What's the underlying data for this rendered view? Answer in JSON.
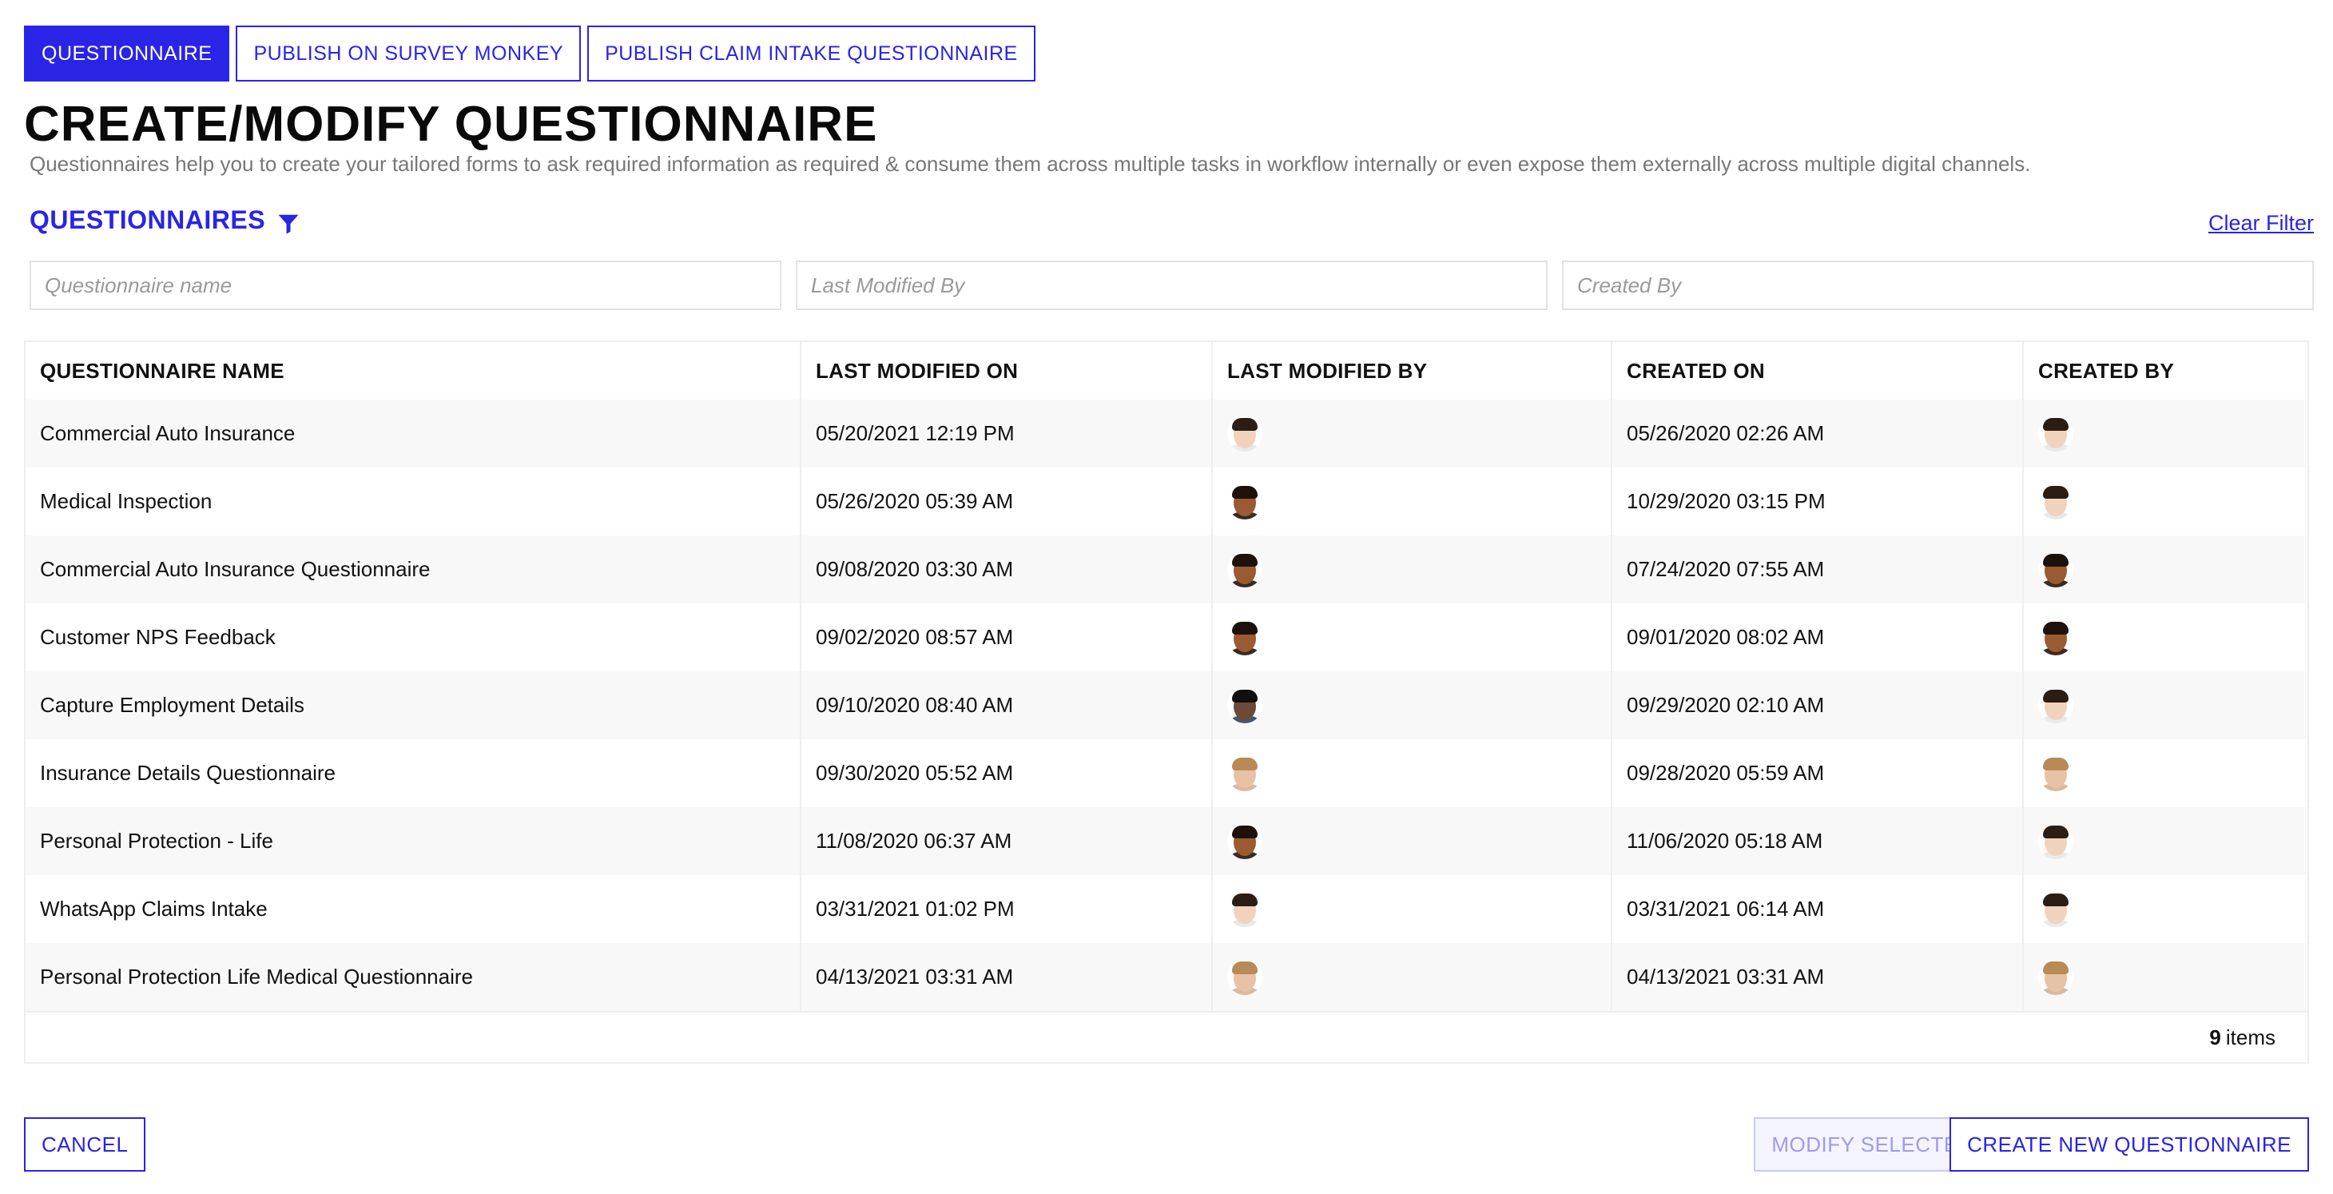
{
  "tabs": [
    {
      "label": "QUESTIONNAIRE",
      "active": true
    },
    {
      "label": "PUBLISH ON SURVEY MONKEY",
      "active": false
    },
    {
      "label": "PUBLISH CLAIM INTAKE QUESTIONNAIRE",
      "active": false
    }
  ],
  "page": {
    "title": "CREATE/MODIFY QUESTIONNAIRE",
    "description": "Questionnaires help you to create your tailored forms to ask required information as required & consume them across multiple tasks in workflow internally or even expose them externally across multiple digital channels."
  },
  "section": {
    "title": "QUESTIONNAIRES",
    "filter_icon": "filter-icon",
    "clear_filter": "Clear Filter"
  },
  "filters": {
    "name_placeholder": "Questionnaire name",
    "modified_by_placeholder": "Last Modified By",
    "created_by_placeholder": "Created By"
  },
  "table": {
    "headers": [
      "QUESTIONNAIRE NAME",
      "LAST MODIFIED ON",
      "LAST MODIFIED BY",
      "CREATED ON",
      "CREATED BY"
    ],
    "rows": [
      {
        "name": "Commercial Auto Insurance",
        "modified_on": "05/20/2021 12:19 PM",
        "modified_by_avatar": "avatar-a",
        "created_on": "05/26/2020 02:26 AM",
        "created_by_avatar": "avatar-a"
      },
      {
        "name": "Medical Inspection",
        "modified_on": "05/26/2020 05:39 AM",
        "modified_by_avatar": "avatar-b",
        "created_on": "10/29/2020 03:15 PM",
        "created_by_avatar": "avatar-a"
      },
      {
        "name": "Commercial Auto Insurance Questionnaire",
        "modified_on": "09/08/2020 03:30 AM",
        "modified_by_avatar": "avatar-b",
        "created_on": "07/24/2020 07:55 AM",
        "created_by_avatar": "avatar-b"
      },
      {
        "name": "Customer NPS Feedback",
        "modified_on": "09/02/2020 08:57 AM",
        "modified_by_avatar": "avatar-b",
        "created_on": "09/01/2020 08:02 AM",
        "created_by_avatar": "avatar-b"
      },
      {
        "name": "Capture Employment Details",
        "modified_on": "09/10/2020 08:40 AM",
        "modified_by_avatar": "avatar-c",
        "created_on": "09/29/2020 02:10 AM",
        "created_by_avatar": "avatar-a"
      },
      {
        "name": "Insurance Details Questionnaire",
        "modified_on": "09/30/2020 05:52 AM",
        "modified_by_avatar": "avatar-d",
        "created_on": "09/28/2020 05:59 AM",
        "created_by_avatar": "avatar-d"
      },
      {
        "name": "Personal Protection - Life",
        "modified_on": "11/08/2020 06:37 AM",
        "modified_by_avatar": "avatar-b",
        "created_on": "11/06/2020 05:18 AM",
        "created_by_avatar": "avatar-a"
      },
      {
        "name": "WhatsApp Claims Intake",
        "modified_on": "03/31/2021 01:02 PM",
        "modified_by_avatar": "avatar-a",
        "created_on": "03/31/2021 06:14 AM",
        "created_by_avatar": "avatar-a"
      },
      {
        "name": "Personal Protection Life Medical Questionnaire",
        "modified_on": "04/13/2021 03:31 AM",
        "modified_by_avatar": "avatar-d",
        "created_on": "04/13/2021 03:31 AM",
        "created_by_avatar": "avatar-d"
      }
    ],
    "item_count": "9",
    "item_label": "items"
  },
  "avatars": {
    "avatar-a": {
      "skin": "#f1d3bd",
      "hair": "#2b1d14",
      "shirt": "#e9e9e9"
    },
    "avatar-b": {
      "skin": "#9a5a32",
      "hair": "#1c110b",
      "shirt": "#3a2a20"
    },
    "avatar-c": {
      "skin": "#6b4a36",
      "hair": "#101010",
      "shirt": "#4a5566"
    },
    "avatar-d": {
      "skin": "#e8c2a6",
      "hair": "#b88a55",
      "shirt": "#d9b9a0"
    }
  },
  "buttons": {
    "cancel": "CANCEL",
    "modify": "MODIFY SELECTED",
    "create": "CREATE NEW QUESTIONNAIRE"
  },
  "colors": {
    "accent": "#2a24e6",
    "disabled_text": "#9d9bf0",
    "row_stripe": "#f8f8f8"
  }
}
